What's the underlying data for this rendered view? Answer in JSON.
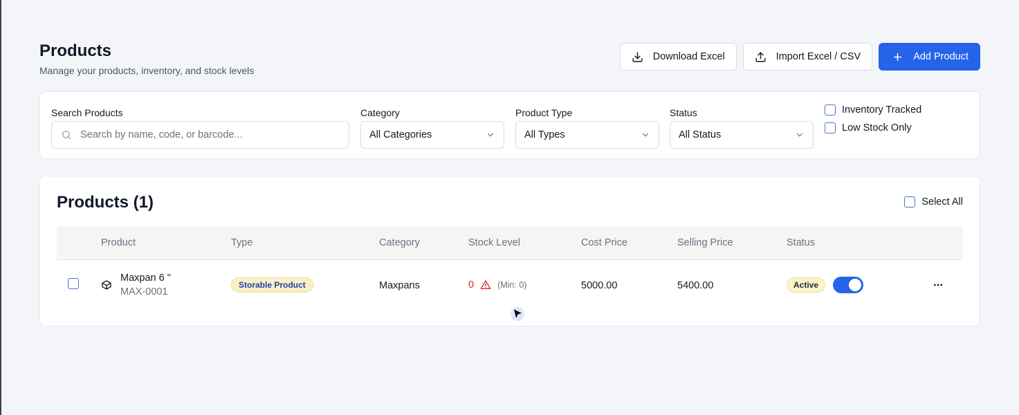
{
  "header": {
    "title": "Products",
    "subtitle": "Manage your products, inventory, and stock levels",
    "download_label": "Download Excel",
    "import_label": "Import Excel / CSV",
    "add_label": "Add Product"
  },
  "filters": {
    "search_label": "Search Products",
    "search_placeholder": "Search by name, code, or barcode...",
    "category_label": "Category",
    "category_value": "All Categories",
    "type_label": "Product Type",
    "type_value": "All Types",
    "status_label": "Status",
    "status_value": "All Status",
    "inventory_tracked_label": "Inventory Tracked",
    "low_stock_label": "Low Stock Only"
  },
  "products": {
    "title": "Products (1)",
    "select_all_label": "Select All",
    "columns": [
      "Product",
      "Type",
      "Category",
      "Stock Level",
      "Cost Price",
      "Selling Price",
      "Status"
    ],
    "rows": [
      {
        "name": "Maxpan 6 \"",
        "code": "MAX-0001",
        "type": "Storable Product",
        "category": "Maxpans",
        "stock": "0",
        "stock_min": "(Min: 0)",
        "cost_price": "5000.00",
        "selling_price": "5400.00",
        "status": "Active",
        "enabled": true
      }
    ]
  },
  "colors": {
    "primary": "#2563eb",
    "danger": "#dc2626",
    "badge_yellow": "#fdf3c7"
  },
  "icons": [
    "download-icon",
    "upload-icon",
    "plus-icon",
    "search-icon",
    "chevron-down-icon",
    "box-icon",
    "warning-icon",
    "more-horizontal-icon",
    "cursor-icon"
  ]
}
